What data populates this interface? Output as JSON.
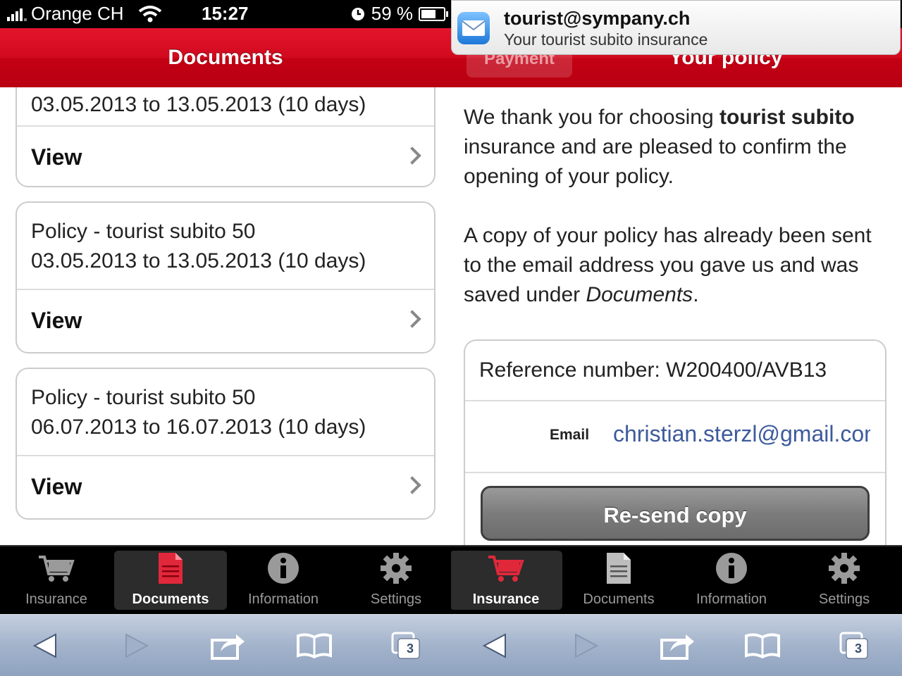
{
  "status_bar": {
    "carrier": "Orange CH",
    "time": "15:27",
    "battery": "59 %"
  },
  "left": {
    "title": "Documents",
    "partial_dates": "03.05.2013 to 13.05.2013 (10 days)",
    "view_label": "View",
    "cards": [
      {
        "title": "Policy - tourist subito 50",
        "dates": "03.05.2013 to 13.05.2013 (10 days)"
      },
      {
        "title": "Policy - tourist subito 50",
        "dates": "06.07.2013 to 16.07.2013 (10 days)"
      }
    ],
    "tabs": [
      "Insurance",
      "Documents",
      "Information",
      "Settings"
    ]
  },
  "right": {
    "title": "Your policy",
    "back_label": "Payment",
    "p1_a": "We thank you for choosing ",
    "p1_bold": "tourist subito",
    "p1_b": " insurance and are pleased to confirm the opening of your policy.",
    "p2_a": "A copy of your policy has already been sent to the email address you gave us and was saved under ",
    "p2_italic": "Documents",
    "p2_b": ".",
    "reference": "Reference number: W200400/AVB13",
    "email_label": "Email",
    "email_value": "christian.sterzl@gmail.com",
    "resend_label": "Re-send copy",
    "tabs": [
      "Insurance",
      "Documents",
      "Information",
      "Settings"
    ]
  },
  "notification": {
    "from": "tourist@sympany.ch",
    "message": "Your tourist subito insurance"
  },
  "toolbar": {
    "tab_count": "3"
  },
  "colors": {
    "header_red": "#d20a1e",
    "link_blue": "#3d5a9e",
    "doc_icon_red": "#e0283a"
  }
}
